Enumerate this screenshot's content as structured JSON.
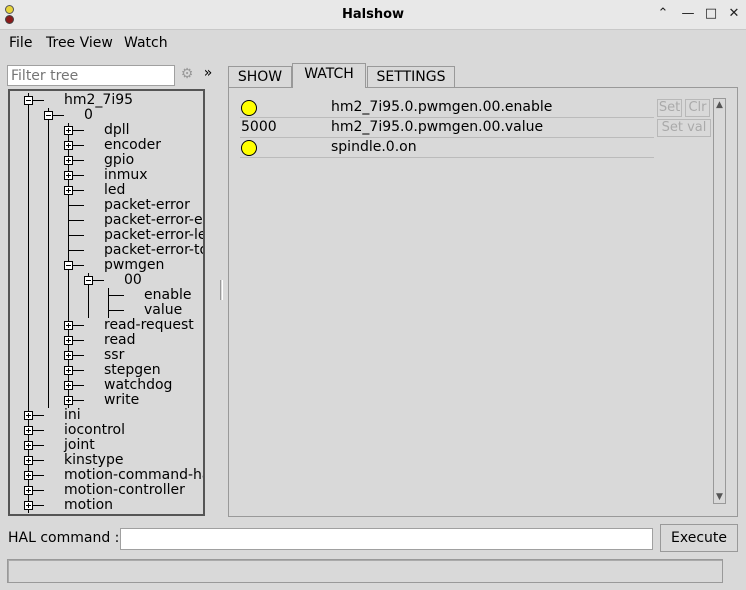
{
  "window": {
    "title": "Halshow"
  },
  "menu": [
    "File",
    "Tree View",
    "Watch"
  ],
  "filter": {
    "placeholder": "Filter tree"
  },
  "tree": [
    {
      "label": "hm2_7i95",
      "depth": 0,
      "toggle": "minus"
    },
    {
      "label": "0",
      "depth": 1,
      "toggle": "minus"
    },
    {
      "label": "dpll",
      "depth": 2,
      "toggle": "plus"
    },
    {
      "label": "encoder",
      "depth": 2,
      "toggle": "plus"
    },
    {
      "label": "gpio",
      "depth": 2,
      "toggle": "plus"
    },
    {
      "label": "inmux",
      "depth": 2,
      "toggle": "plus"
    },
    {
      "label": "led",
      "depth": 2,
      "toggle": "plus"
    },
    {
      "label": "packet-error",
      "depth": 2,
      "toggle": "none"
    },
    {
      "label": "packet-error-exceeded",
      "depth": 2,
      "toggle": "none"
    },
    {
      "label": "packet-error-level",
      "depth": 2,
      "toggle": "none"
    },
    {
      "label": "packet-error-total",
      "depth": 2,
      "toggle": "none"
    },
    {
      "label": "pwmgen",
      "depth": 2,
      "toggle": "minus"
    },
    {
      "label": "00",
      "depth": 3,
      "toggle": "minus"
    },
    {
      "label": "enable",
      "depth": 4,
      "toggle": "none"
    },
    {
      "label": "value",
      "depth": 4,
      "toggle": "none"
    },
    {
      "label": "read-request",
      "depth": 2,
      "toggle": "plus"
    },
    {
      "label": "read",
      "depth": 2,
      "toggle": "plus"
    },
    {
      "label": "ssr",
      "depth": 2,
      "toggle": "plus"
    },
    {
      "label": "stepgen",
      "depth": 2,
      "toggle": "plus"
    },
    {
      "label": "watchdog",
      "depth": 2,
      "toggle": "plus"
    },
    {
      "label": "write",
      "depth": 2,
      "toggle": "plus"
    },
    {
      "label": "ini",
      "depth": 0,
      "toggle": "plus"
    },
    {
      "label": "iocontrol",
      "depth": 0,
      "toggle": "plus"
    },
    {
      "label": "joint",
      "depth": 0,
      "toggle": "plus"
    },
    {
      "label": "kinstype",
      "depth": 0,
      "toggle": "plus"
    },
    {
      "label": "motion-command-handler",
      "depth": 0,
      "toggle": "plus"
    },
    {
      "label": "motion-controller",
      "depth": 0,
      "toggle": "plus"
    },
    {
      "label": "motion",
      "depth": 0,
      "toggle": "plus"
    }
  ],
  "tabs": [
    {
      "label": "SHOW",
      "active": false
    },
    {
      "label": "WATCH",
      "active": true
    },
    {
      "label": "SETTINGS",
      "active": false
    }
  ],
  "watch": [
    {
      "kind": "led",
      "value": "",
      "name": "hm2_7i95.0.pwmgen.00.enable",
      "buttons": [
        "Set",
        "Clr"
      ]
    },
    {
      "kind": "value",
      "value": "5000",
      "name": "hm2_7i95.0.pwmgen.00.value",
      "buttons": [
        "Set val"
      ]
    },
    {
      "kind": "led",
      "value": "",
      "name": "spindle.0.on",
      "buttons": []
    }
  ],
  "hal": {
    "label": "HAL command :",
    "value": "",
    "execute_label": "Execute"
  },
  "colors": {
    "led_on": "#ffff00",
    "background": "#d9d9d9"
  }
}
